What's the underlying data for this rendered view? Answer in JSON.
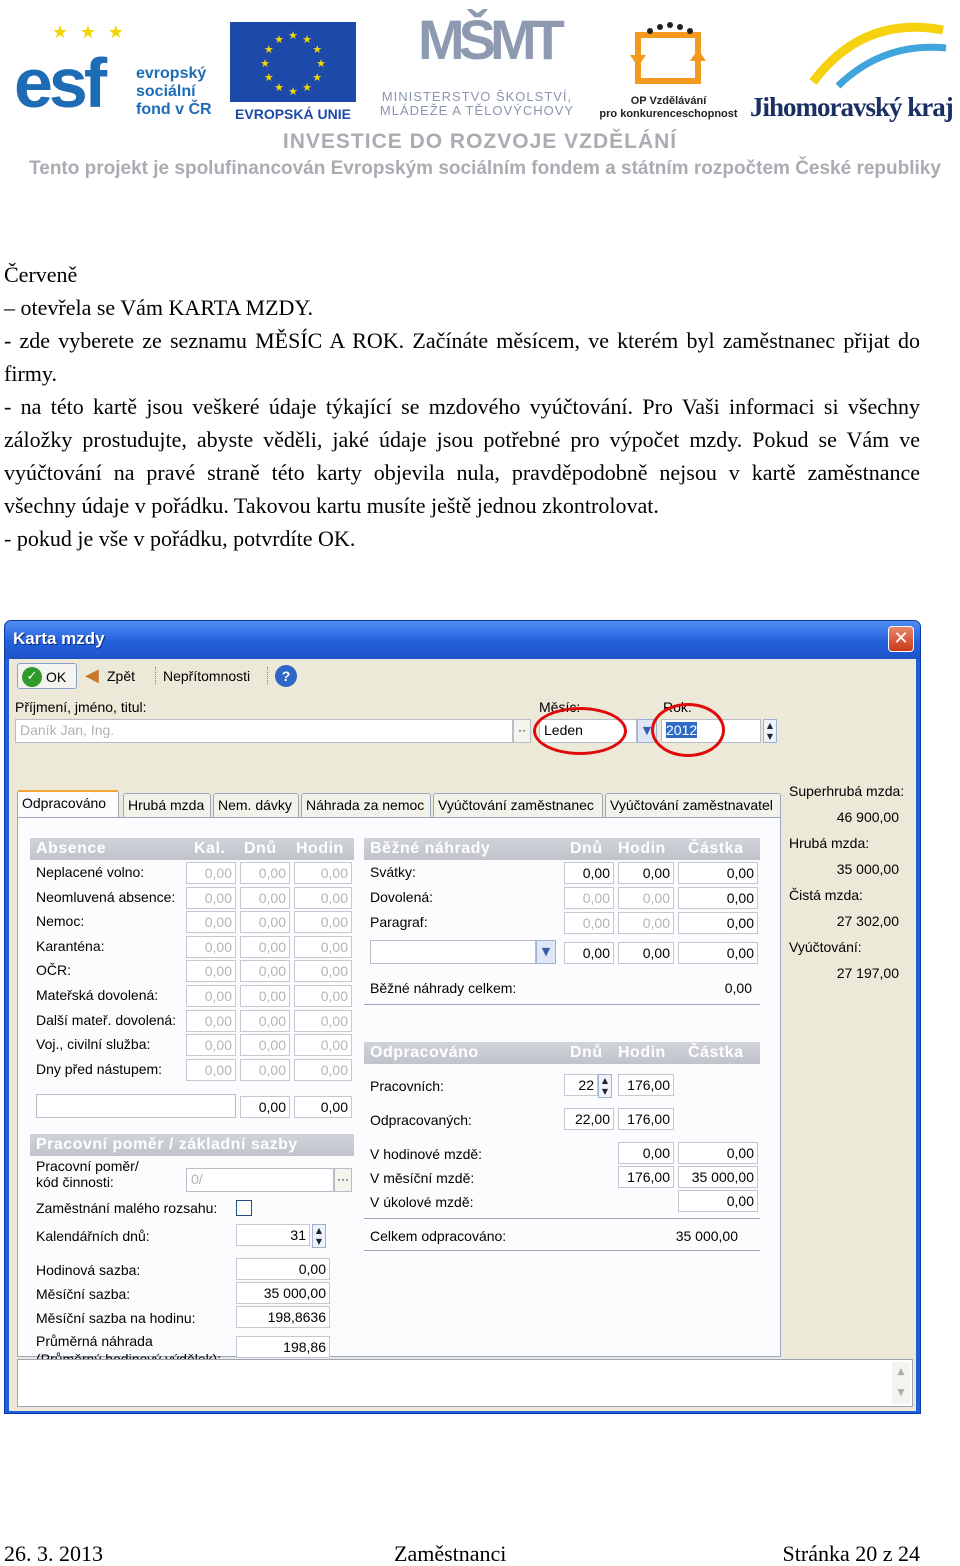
{
  "header": {
    "esf": {
      "big": "esf",
      "line1": "evropský",
      "line2": "sociální",
      "line3": "fond v ČR"
    },
    "eu": {
      "label": "EVROPSKÁ UNIE"
    },
    "msmt": {
      "mark": "MŠMT",
      "line1": "MINISTERSTVO ŠKOLSTVÍ,",
      "line2": "MLÁDEŽE A TĚLOVÝCHOVY"
    },
    "op": {
      "line1": "OP Vzdělávání",
      "line2": "pro konkurenceschopnost"
    },
    "jmk": {
      "label": "Jihomoravský kraj"
    },
    "invest": "INVESTICE DO ROZVOJE VZDĚLÁNÍ",
    "cofund": "Tento projekt je spolufinancován Evropským sociálním fondem a státním rozpočtem České republiky",
    "colors": {
      "esf_blue": "#1f6cb6",
      "eu_blue": "#1d49a8",
      "eu_star": "#f3d600",
      "msmt_gray": "#8e9ab2",
      "op_orange": "#f39a1e",
      "jmk_navy": "#1a2f63"
    }
  },
  "doc": {
    "p1": "Červeně",
    "p2": "– otevřela se Vám KARTA MZDY.",
    "p3": "- zde vyberete ze seznamu MĚSÍC A ROK. Začínáte měsícem, ve kterém byl zaměstnanec přijat do firmy.",
    "p4": "- na této kartě jsou veškeré údaje týkající se mzdového vyúčtování. Pro Vaši informaci si všechny záložky prostudujte, abyste věděli, jaké údaje jsou potřebné pro výpočet mzdy. Pokud se Vám ve vyúčtování na pravé straně této karty objevila nula, pravděpodobně nejsou v kartě zaměstnance všechny údaje v pořádku. Takovou kartu musíte ještě jednou zkontrolovat.",
    "p5": "- pokud je vše v pořádku, potvrdíte OK."
  },
  "window": {
    "title": "Karta mzdy",
    "close": "✕",
    "toolbar": {
      "ok": "OK",
      "back": "Zpět",
      "absence": "Nepřítomnosti",
      "help": "?"
    },
    "icons": {
      "ok": "check-icon",
      "back": "back-arrow-icon",
      "help": "help-icon"
    },
    "name_label": "Příjmení, jméno, titul:",
    "name_value": "Daník Jan, Ing.",
    "month_label": "Měsíc:",
    "month_value": "Leden",
    "year_label": "Rok:",
    "year_value": "2012",
    "tabs": [
      "Odpracováno",
      "Hrubá mzda",
      "Nem. dávky",
      "Náhrada za nemoc",
      "Vyúčtování zaměstnanec",
      "Vyúčtování zaměstnavatel"
    ],
    "absence": {
      "title": "Absence",
      "col_kal": "Kal.",
      "col_dnu": "Dnů",
      "col_hod": "Hodin",
      "rows": [
        {
          "label": "Neplacené volno:",
          "kal": "0,00",
          "dnu": "0,00",
          "hod": "0,00"
        },
        {
          "label": "Neomluvená absence:",
          "kal": "0,00",
          "dnu": "0,00",
          "hod": "0,00"
        },
        {
          "label": "Nemoc:",
          "kal": "0,00",
          "dnu": "0,00",
          "hod": "0,00"
        },
        {
          "label": "Karanténa:",
          "kal": "0,00",
          "dnu": "0,00",
          "hod": "0,00"
        },
        {
          "label": "OČR:",
          "kal": "0,00",
          "dnu": "0,00",
          "hod": "0,00"
        },
        {
          "label": "Mateřská dovolená:",
          "kal": "0,00",
          "dnu": "0,00",
          "hod": "0,00"
        },
        {
          "label": "Další mateř. dovolená:",
          "kal": "0,00",
          "dnu": "0,00",
          "hod": "0,00"
        },
        {
          "label": "Voj., civilní služba:",
          "kal": "0,00",
          "dnu": "0,00",
          "hod": "0,00"
        },
        {
          "label": "Dny před nástupem:",
          "kal": "0,00",
          "dnu": "0,00",
          "hod": "0,00"
        }
      ],
      "extra_dnu": "0,00",
      "extra_hod": "0,00"
    },
    "pomer": {
      "title": "Pracovní poměr / základní sazby",
      "pomer_label1": "Pracovní poměr/",
      "pomer_label2": "kód činnosti:",
      "pomer_value": "0/",
      "maly_label": "Zaměstnání malého rozsahu:",
      "kal_label": "Kalendářních dnů:",
      "kal_value": "31",
      "hod_label": "Hodinová sazba:",
      "hod_value": "0,00",
      "mes_label": "Měsíční sazba:",
      "mes_value": "35 000,00",
      "mesh_label": "Měsíční sazba na hodinu:",
      "mesh_value": "198,8636",
      "prum_label1": "Průměrná náhrada",
      "prum_label2": "(Průměrný hodinový výdělek):",
      "prum_value": "198,86"
    },
    "nahrady": {
      "title": "Běžné náhrady",
      "col_dnu": "Dnů",
      "col_hod": "Hodin",
      "col_castka": "Částka",
      "rows": [
        {
          "label": "Svátky:",
          "dnu": "0,00",
          "hod": "0,00",
          "castka": "0,00"
        },
        {
          "label": "Dovolená:",
          "dnu": "0,00",
          "hod": "0,00",
          "castka": "0,00"
        },
        {
          "label": "Paragraf:",
          "dnu": "0,00",
          "hod": "0,00",
          "castka": "0,00"
        }
      ],
      "drop_dnu": "0,00",
      "drop_hod": "0,00",
      "drop_castka": "0,00",
      "total_label": "Běžné náhrady celkem:",
      "total_value": "0,00"
    },
    "odpracovano": {
      "title": "Odpracováno",
      "col_dnu": "Dnů",
      "col_hod": "Hodin",
      "col_castka": "Částka",
      "prac_label": "Pracovních:",
      "prac_dnu": "22",
      "prac_hod": "176,00",
      "odpr_label": "Odpracovaných:",
      "odpr_dnu": "22,00",
      "odpr_hod": "176,00",
      "hod_label": "V hodinové mzdě:",
      "hod_hod": "0,00",
      "hod_castka": "0,00",
      "mes_label": "V měsíční mzdě:",
      "mes_hod": "176,00",
      "mes_castka": "35 000,00",
      "uk_label": "V úkolové mzdě:",
      "uk_castka": "0,00",
      "total_label": "Celkem odpracováno:",
      "total_value": "35 000,00"
    },
    "summary": {
      "super_label": "Superhrubá mzda:",
      "super_value": "46 900,00",
      "hruba_label": "Hrubá mzda:",
      "hruba_value": "35 000,00",
      "cista_label": "Čistá mzda:",
      "cista_value": "27 302,00",
      "vyuct_label": "Vyúčtování:",
      "vyuct_value": "27 197,00"
    }
  },
  "footer": {
    "date": "26. 3. 2013",
    "title": "Zaměstnanci",
    "page": "Stránka 20 z 24"
  }
}
